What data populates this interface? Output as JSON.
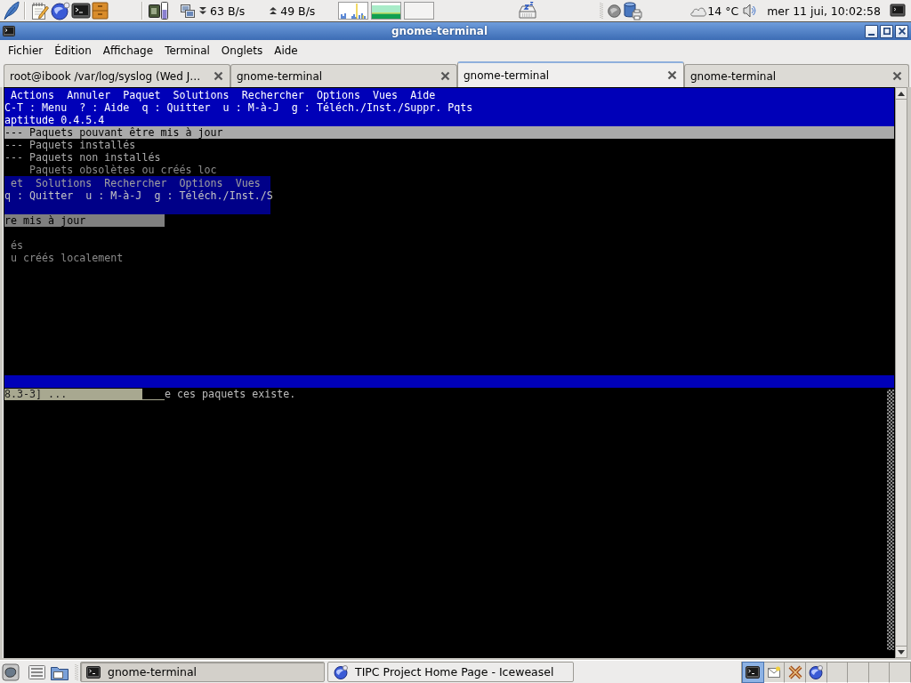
{
  "top_panel": {
    "download_rate": "63 B/s",
    "upload_rate": "49 B/s",
    "weather": "14 °C",
    "clock": "mer 11 jui, 10:02:58"
  },
  "window": {
    "title": "gnome-terminal"
  },
  "menu": [
    "Fichier",
    "Édition",
    "Affichage",
    "Terminal",
    "Onglets",
    "Aide"
  ],
  "tabs": [
    {
      "label": "root@ibook /var/log/syslog (Wed J…",
      "selected": false
    },
    {
      "label": "gnome-terminal",
      "selected": false
    },
    {
      "label": "gnome-terminal",
      "selected": true
    },
    {
      "label": "gnome-terminal",
      "selected": false
    }
  ],
  "terminal": {
    "menu": [
      "Actions",
      "Annuler",
      "Paquet",
      "Solutions",
      "Rechercher",
      "Options",
      "Vues",
      "Aide"
    ],
    "keys": "C-T : Menu  ? : Aide  q : Quitter  u : M-à-J  g : Téléch./Inst./Suppr. Pqts",
    "title": "aptitude 0.4.5.4",
    "groups": [
      {
        "label": "--- Paquets pouvant être mis à jour",
        "selected": true
      },
      {
        "label": "--- Paquets installés",
        "selected": false
      },
      {
        "label": "--- Paquets non installés",
        "selected": false
      }
    ],
    "stray": "Paquets obsolètes ou créés loc",
    "ghost": {
      "menu": "et  Solutions  Rechercher  Options  Vues",
      "keys": "q : Quitter  u : M-à-J  g : Téléch./Inst./S",
      "highlight": "re mis à jour",
      "items": [
        "és",
        "u créés localement"
      ]
    },
    "info_line": {
      "highlight": "8.3-3] ...",
      "text": "e ces paquets existe."
    }
  },
  "taskbar": {
    "tasks": [
      {
        "label": "gnome-terminal",
        "kind": "terminal",
        "selected": true
      },
      {
        "label": "TIPC Project Home Page - Iceweasel",
        "kind": "browser",
        "selected": false
      }
    ],
    "workspaces": [
      {
        "kind": "terminal",
        "selected": true
      },
      {
        "kind": "mail",
        "selected": false
      },
      {
        "kind": "puzzle",
        "selected": false
      },
      {
        "kind": "browser",
        "selected": false
      },
      {
        "selected": false
      },
      {
        "selected": false
      },
      {
        "selected": false
      },
      {
        "selected": false
      }
    ]
  }
}
